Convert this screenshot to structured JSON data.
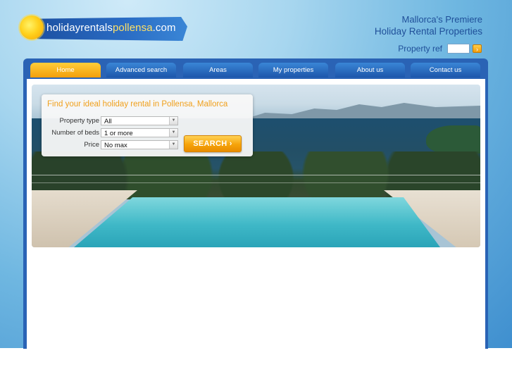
{
  "brand": {
    "logo_prefix": "holidayrentals",
    "logo_highlight": "pollensa",
    "logo_suffix": ".com",
    "tagline_line1": "Mallorca's Premiere",
    "tagline_line2": "Holiday Rental Properties"
  },
  "property_ref": {
    "label": "Property ref",
    "value": "",
    "go_label": "›"
  },
  "nav": {
    "tabs": [
      {
        "label": "Home",
        "active": true
      },
      {
        "label": "Advanced search",
        "active": false
      },
      {
        "label": "Areas",
        "active": false
      },
      {
        "label": "My properties",
        "active": false
      },
      {
        "label": "About us",
        "active": false
      },
      {
        "label": "Contact us",
        "active": false
      }
    ]
  },
  "search": {
    "heading": "Find your ideal holiday rental in Pollensa, Mallorca",
    "fields": [
      {
        "label": "Property type",
        "value": "All"
      },
      {
        "label": "Number of beds",
        "value": "1 or more"
      },
      {
        "label": "Price",
        "value": "No max"
      }
    ],
    "button_label": "SEARCH ›"
  },
  "colors": {
    "accent_orange": "#f6a309",
    "nav_blue": "#1d56ab",
    "brand_blue": "#1f4f99"
  },
  "hero": {
    "icon": "pool-seaview-photo"
  }
}
